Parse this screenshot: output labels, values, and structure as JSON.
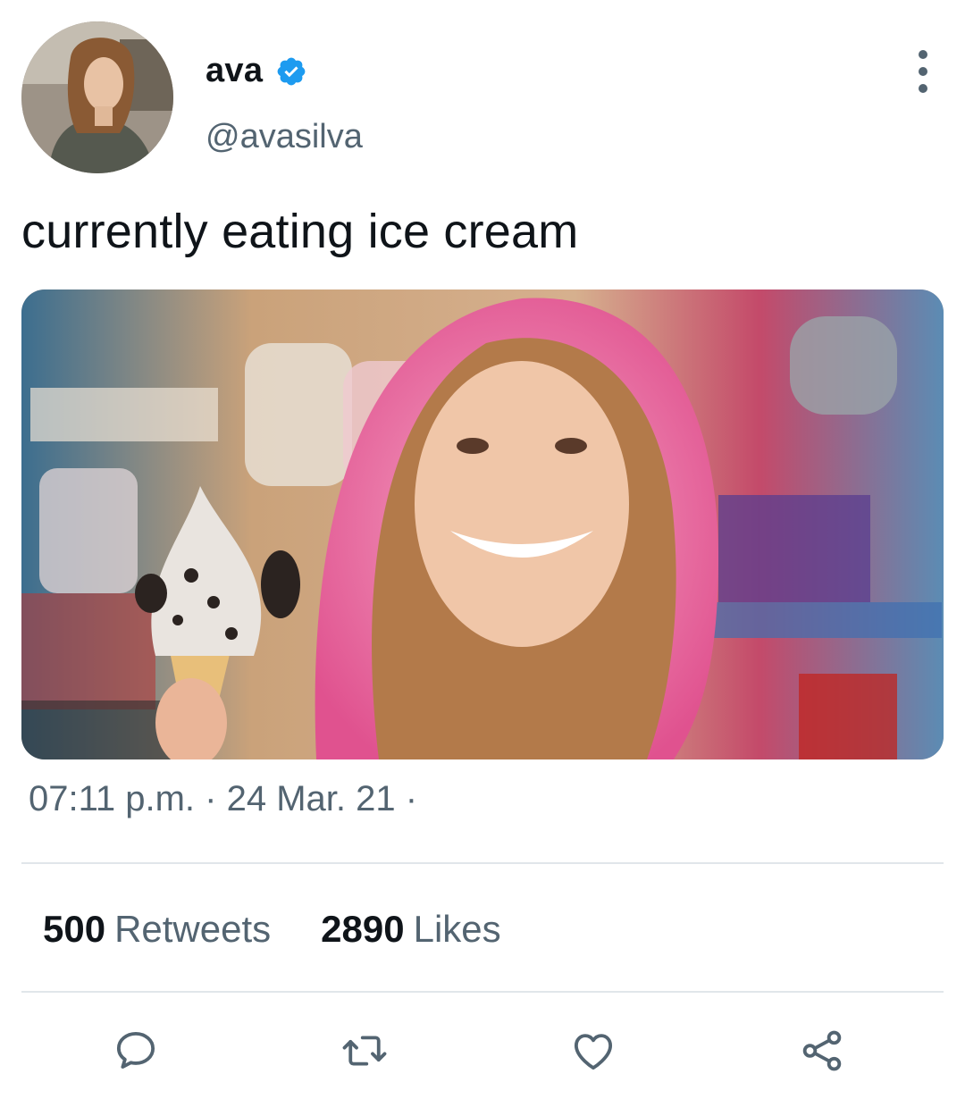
{
  "tweet": {
    "author": {
      "display_name": "ava",
      "handle": "@avasilva",
      "verified": true
    },
    "text": "currently eating ice cream",
    "timestamp": "07:11 p.m. · 24 Mar. 21 ·"
  },
  "stats": {
    "retweets_count": "500",
    "retweets_label": "Retweets",
    "likes_count": "2890",
    "likes_label": "Likes"
  },
  "actions": {
    "reply_icon": "reply-icon",
    "retweet_icon": "retweet-icon",
    "like_icon": "heart-icon",
    "share_icon": "share-icon"
  },
  "colors": {
    "accent": "#1d9bf0",
    "secondary_text": "#536471",
    "divider": "#e1e6ea"
  }
}
